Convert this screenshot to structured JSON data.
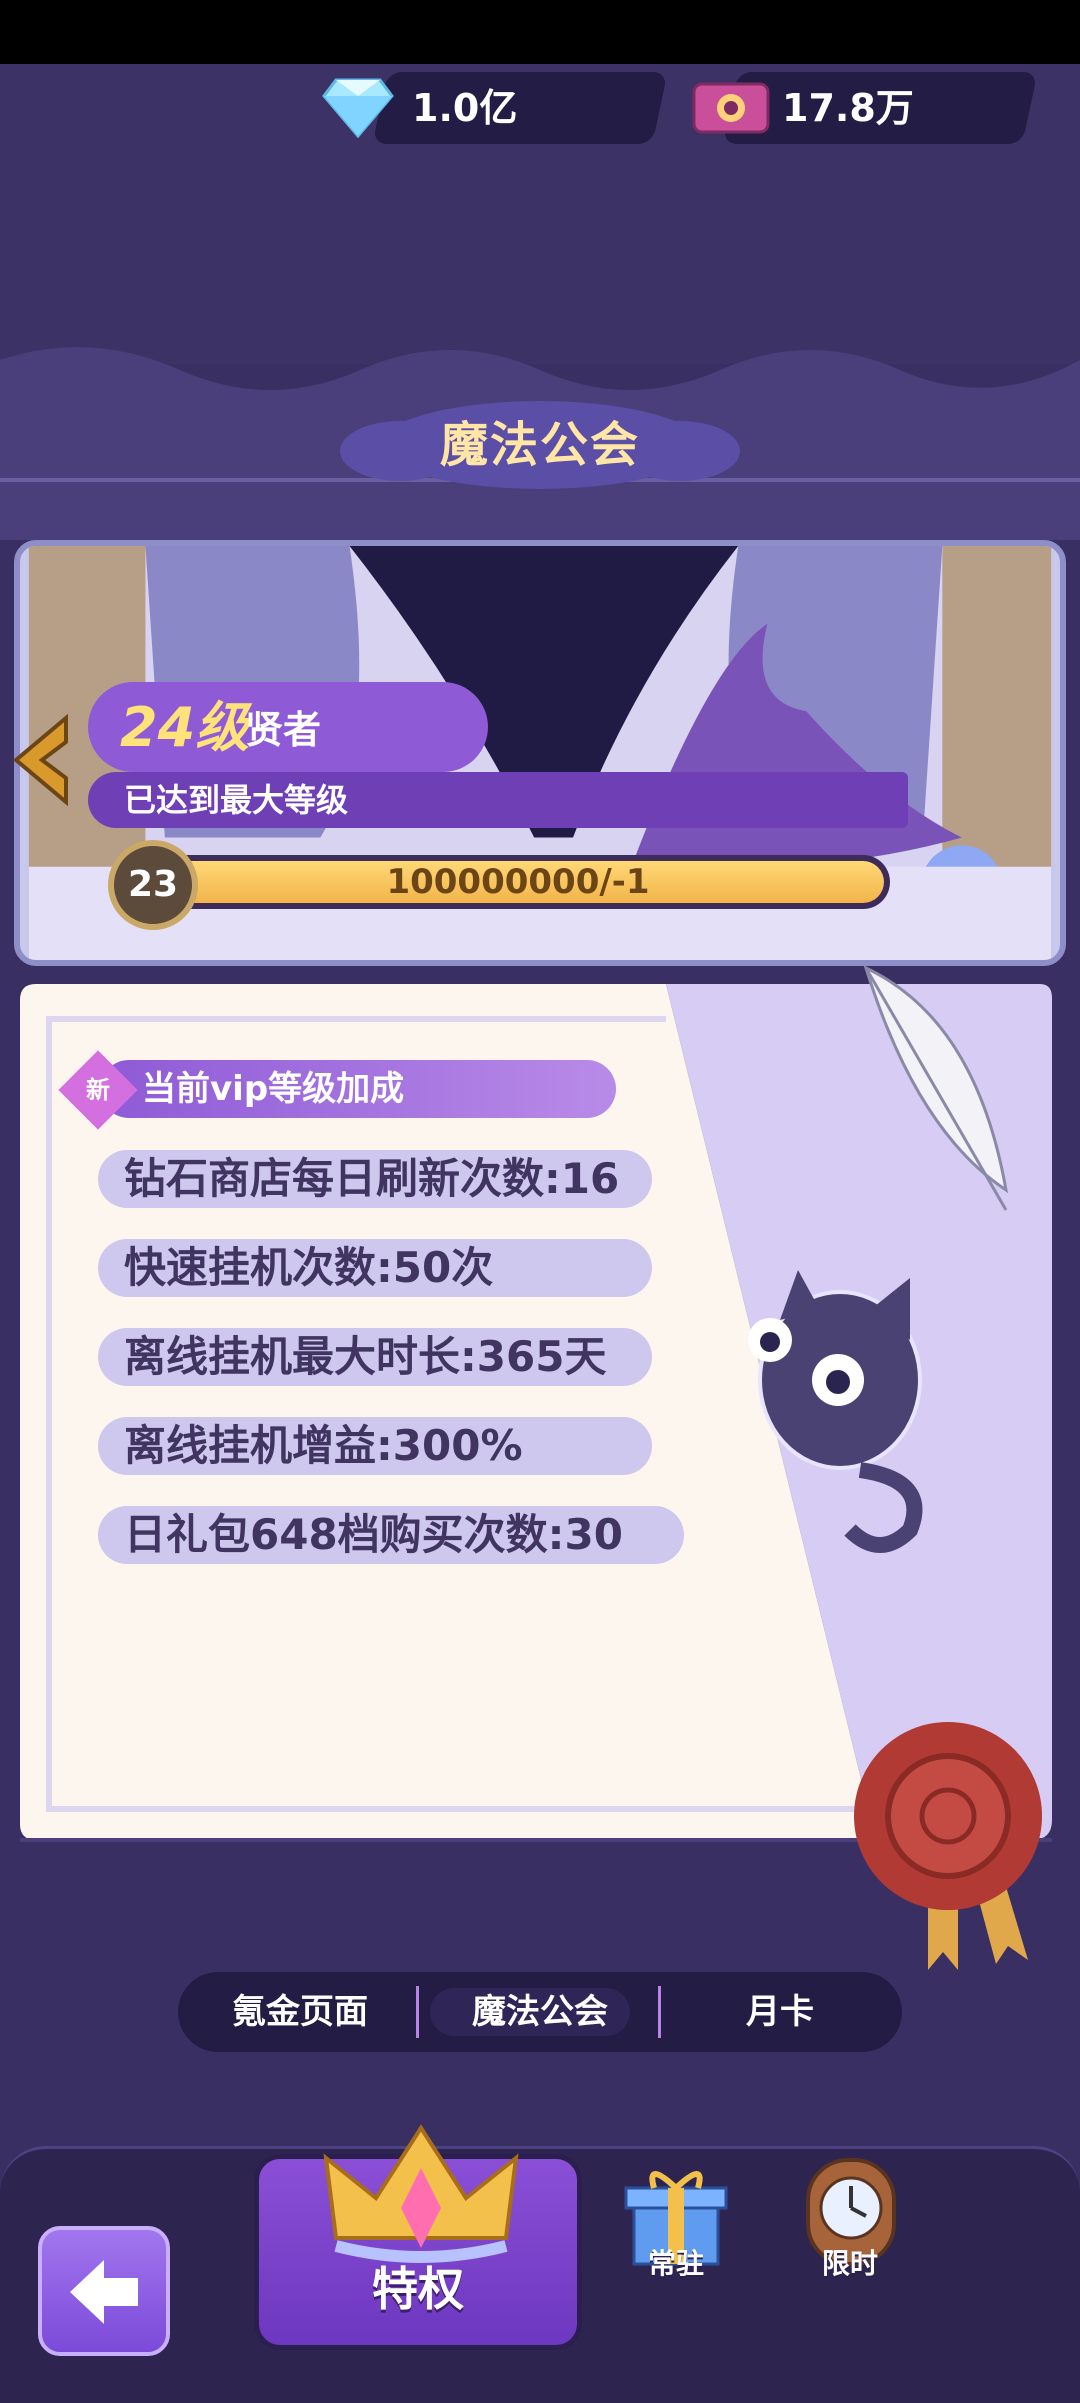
{
  "currency": {
    "diamond": {
      "icon": "diamond-icon",
      "value": "1.0亿"
    },
    "ticket": {
      "icon": "ticket-icon",
      "value": "17.8万"
    }
  },
  "page_title": "魔法公会",
  "guild_banner": {
    "level_number": "24级",
    "level_name": "贤者",
    "max_level_text": "已达到最大等级",
    "badge_level": "23",
    "progress_text": "100000000/-1",
    "progress_fraction": 1.0
  },
  "vip_card": {
    "new_badge": "新",
    "header": "当前vip等级加成",
    "benefits": [
      "钻石商店每日刷新次数:16",
      "快速挂机次数:50次",
      "离线挂机最大时长:365天",
      "离线挂机增益:300%",
      "日礼包648档购买次数:30"
    ]
  },
  "tabs": [
    "氪金页面",
    "魔法公会",
    "月卡"
  ],
  "active_tab": 1,
  "bottom_nav": {
    "privilege": "特权",
    "permanent": "常驻",
    "limited": "限时"
  },
  "colors": {
    "background": "#3a2f63",
    "accent_purple": "#8e5ad6",
    "gold": "#ffd877",
    "card_cream": "#fdf6ee"
  }
}
